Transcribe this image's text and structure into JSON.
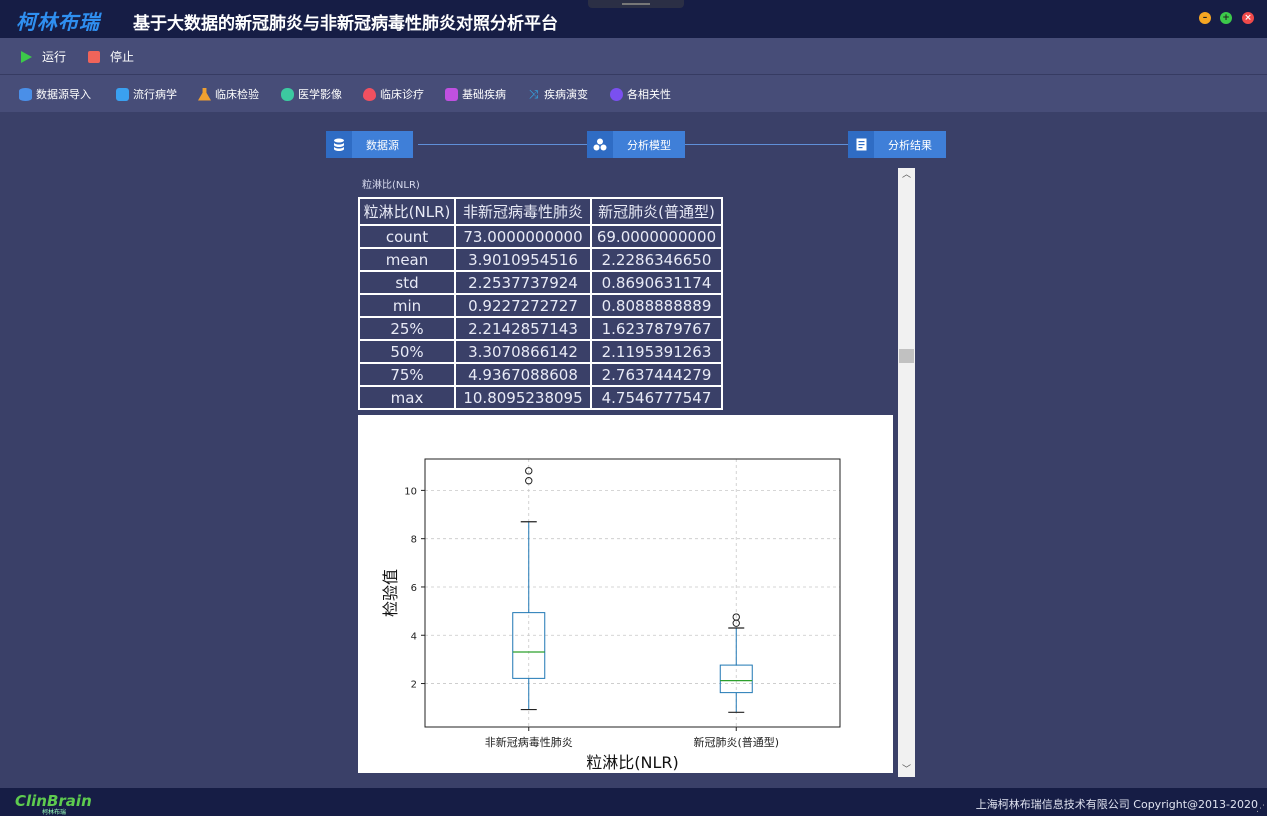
{
  "titlebar": {
    "logo": "柯林布瑞",
    "title": "基于大数据的新冠肺炎与非新冠病毒性肺炎对照分析平台",
    "buttons": [
      "minimize",
      "maximize",
      "close"
    ]
  },
  "runbar": {
    "run_label": "运行",
    "stop_label": "停止"
  },
  "modules": [
    {
      "label": "数据源导入",
      "icon": "database-icon",
      "color": "#4a8fe8"
    },
    {
      "label": "流行病学",
      "icon": "medical-kit-icon",
      "color": "#3aa0f0"
    },
    {
      "label": "临床检验",
      "icon": "flask-icon",
      "color": "#f0a030"
    },
    {
      "label": "医学影像",
      "icon": "lungs-icon",
      "color": "#3cc9a0"
    },
    {
      "label": "临床诊疗",
      "icon": "heart-pulse-icon",
      "color": "#f05060"
    },
    {
      "label": "基础疾病",
      "icon": "plus-square-icon",
      "color": "#c050e0"
    },
    {
      "label": "疾病演变",
      "icon": "shuffle-icon",
      "color": "#30b0f0"
    },
    {
      "label": "各相关性",
      "icon": "circle-icon",
      "color": "#7a50f0"
    }
  ],
  "steps": [
    {
      "label": "数据源",
      "icon": "database-icon"
    },
    {
      "label": "分析模型",
      "icon": "cubes-icon"
    },
    {
      "label": "分析结果",
      "icon": "report-icon"
    }
  ],
  "section_label": "粒淋比(NLR)",
  "stats_table": {
    "headers": [
      "粒淋比(NLR)",
      "非新冠病毒性肺炎",
      "新冠肺炎(普通型)"
    ],
    "rows": [
      [
        "count",
        "73.0000000000",
        "69.0000000000"
      ],
      [
        "mean",
        "3.9010954516",
        "2.2286346650"
      ],
      [
        "std",
        "2.2537737924",
        "0.8690631174"
      ],
      [
        "min",
        "0.9227272727",
        "0.8088888889"
      ],
      [
        "25%",
        "2.2142857143",
        "1.6237879767"
      ],
      [
        "50%",
        "3.3070866142",
        "2.1195391263"
      ],
      [
        "75%",
        "4.9367088608",
        "2.7637444279"
      ],
      [
        "max",
        "10.8095238095",
        "4.7546777547"
      ]
    ]
  },
  "chart_data": {
    "type": "box",
    "title": "",
    "xlabel": "粒淋比(NLR)",
    "ylabel": "检验值",
    "categories": [
      "非新冠病毒性肺炎",
      "新冠肺炎(普通型)"
    ],
    "ylim": [
      0.2,
      11.3
    ],
    "yticks": [
      2,
      4,
      6,
      8,
      10
    ],
    "grid": true,
    "boxes": [
      {
        "q1": 2.2142857143,
        "median": 3.3070866142,
        "q3": 4.9367088608,
        "whisker_low": 0.9227272727,
        "whisker_high": 8.7,
        "outliers": [
          10.4,
          10.8095238095
        ]
      },
      {
        "q1": 1.6237879767,
        "median": 2.1195391263,
        "q3": 2.7637444279,
        "whisker_low": 0.8088888889,
        "whisker_high": 4.3,
        "outliers": [
          4.5,
          4.7546777547
        ]
      }
    ],
    "box_color": "#1f77b4",
    "median_color": "#2ca02c"
  },
  "footer": {
    "logo": "ClinBrain",
    "logo_sub": "柯林布瑞",
    "copyright": "上海柯林布瑞信息技术有限公司 Copyright@2013-2020"
  }
}
